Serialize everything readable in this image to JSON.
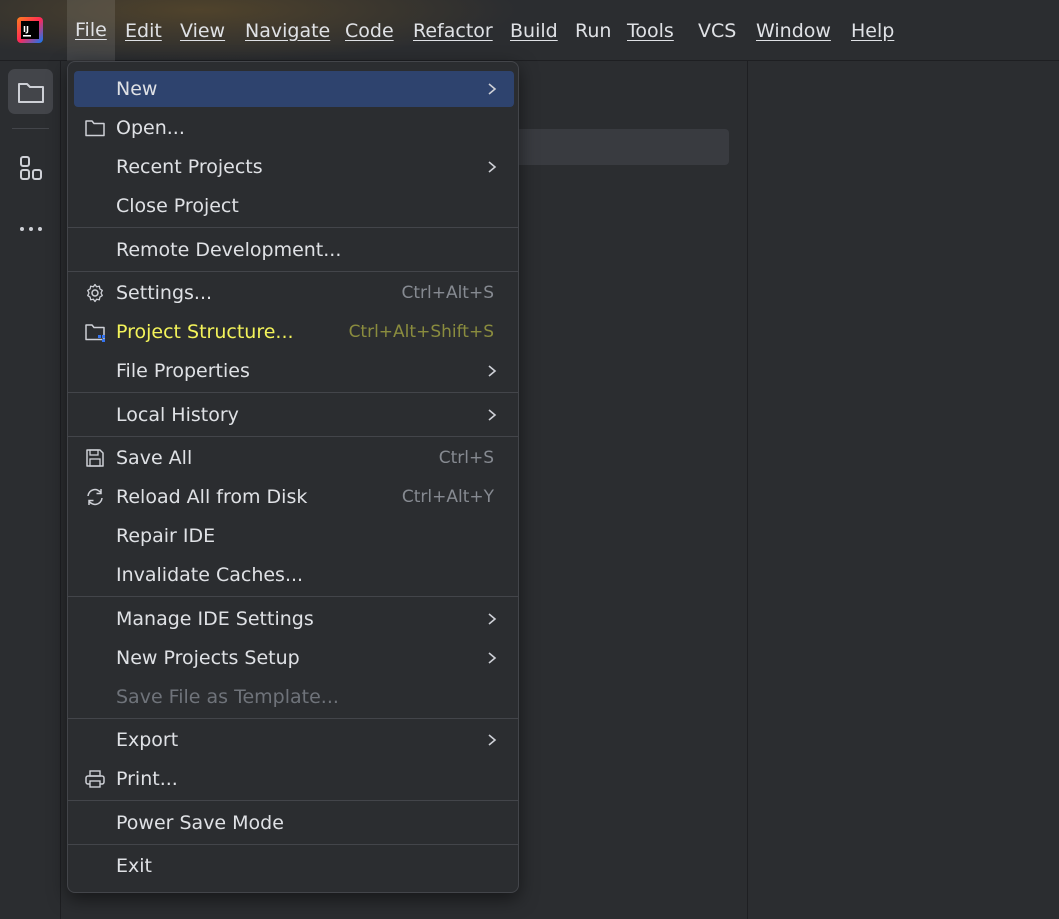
{
  "menubar": {
    "items": [
      {
        "label": "File",
        "active": true
      },
      {
        "label": "Edit"
      },
      {
        "label": "View"
      },
      {
        "label": "Navigate"
      },
      {
        "label": "Code"
      },
      {
        "label": "Refactor"
      },
      {
        "label": "Build"
      },
      {
        "label": "Run"
      },
      {
        "label": "Tools"
      },
      {
        "label": "VCS"
      },
      {
        "label": "Window"
      },
      {
        "label": "Help"
      }
    ]
  },
  "app_logo": {
    "text": "IJ",
    "icon": "intellij-logo-icon"
  },
  "toolstrip": {
    "project_icon": "folder-icon",
    "structure_icon": "structure-icon",
    "more_icon": "more-icon"
  },
  "file_menu": {
    "items": [
      {
        "key": "new",
        "label": "New",
        "submenu": true,
        "selected": true
      },
      {
        "key": "open",
        "label": "Open...",
        "icon": "folder-icon"
      },
      {
        "key": "recent",
        "label": "Recent Projects",
        "submenu": true
      },
      {
        "key": "close",
        "label": "Close Project"
      },
      {
        "key": "remote",
        "label": "Remote Development..."
      },
      {
        "key": "settings",
        "label": "Settings...",
        "shortcut": "Ctrl+Alt+S",
        "icon": "gear-icon"
      },
      {
        "key": "structure",
        "label": "Project Structure...",
        "shortcut": "Ctrl+Alt+Shift+S",
        "icon": "project-structure-icon",
        "highlighted": true
      },
      {
        "key": "fileprops",
        "label": "File Properties",
        "submenu": true
      },
      {
        "key": "history",
        "label": "Local History",
        "submenu": true
      },
      {
        "key": "saveall",
        "label": "Save All",
        "shortcut": "Ctrl+S",
        "icon": "save-icon"
      },
      {
        "key": "reload",
        "label": "Reload All from Disk",
        "shortcut": "Ctrl+Alt+Y",
        "icon": "reload-icon"
      },
      {
        "key": "repair",
        "label": "Repair IDE"
      },
      {
        "key": "invalidate",
        "label": "Invalidate Caches..."
      },
      {
        "key": "manage",
        "label": "Manage IDE Settings",
        "submenu": true
      },
      {
        "key": "newsetup",
        "label": "New Projects Setup",
        "submenu": true
      },
      {
        "key": "template",
        "label": "Save File as Template...",
        "disabled": true
      },
      {
        "key": "export",
        "label": "Export",
        "submenu": true
      },
      {
        "key": "print",
        "label": "Print...",
        "icon": "printer-icon"
      },
      {
        "key": "powersave",
        "label": "Power Save Mode"
      },
      {
        "key": "exit",
        "label": "Exit"
      }
    ]
  },
  "colors": {
    "menu_bg": "#2b2d30",
    "selection": "#2e436e",
    "highlight_marker": "#4a4c0a",
    "highlight_text": "#f3f35a"
  }
}
